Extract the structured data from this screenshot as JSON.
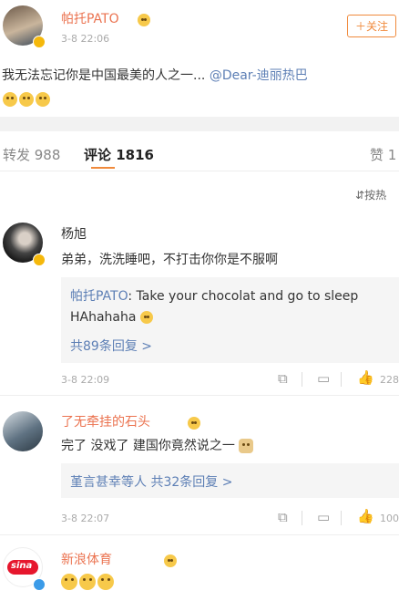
{
  "post": {
    "author": "帕托PATO",
    "time": "3-8 22:06",
    "follow_label": "＋关注",
    "text": "我无法忘记你是中国最美的人之一... ",
    "mention": "@Dear-迪丽热巴"
  },
  "tabs": {
    "repost": "转发 988",
    "comment": "评论 1816",
    "like": "赞 1"
  },
  "sort_label": "按热",
  "comments": [
    {
      "author": "杨旭",
      "text": "弟弟，洗洗睡吧，不打击你你是不服啊",
      "reply_author": "帕托PATO",
      "reply_text": ": Take your chocolat and go to sleep",
      "reply_text2": "HAhahaha",
      "reply_count": "共89条回复 >",
      "time": "3-8 22:09",
      "likes": "228"
    },
    {
      "author": "了无牵挂的石头",
      "text": "完了 没戏了 建国你竟然说之一",
      "reply_users": "堇言甚幸等人",
      "reply_count": "共32条回复 >",
      "time": "3-8 22:07",
      "likes": "100"
    },
    {
      "author": "新浪体育",
      "avatar_text": "sina"
    }
  ]
}
